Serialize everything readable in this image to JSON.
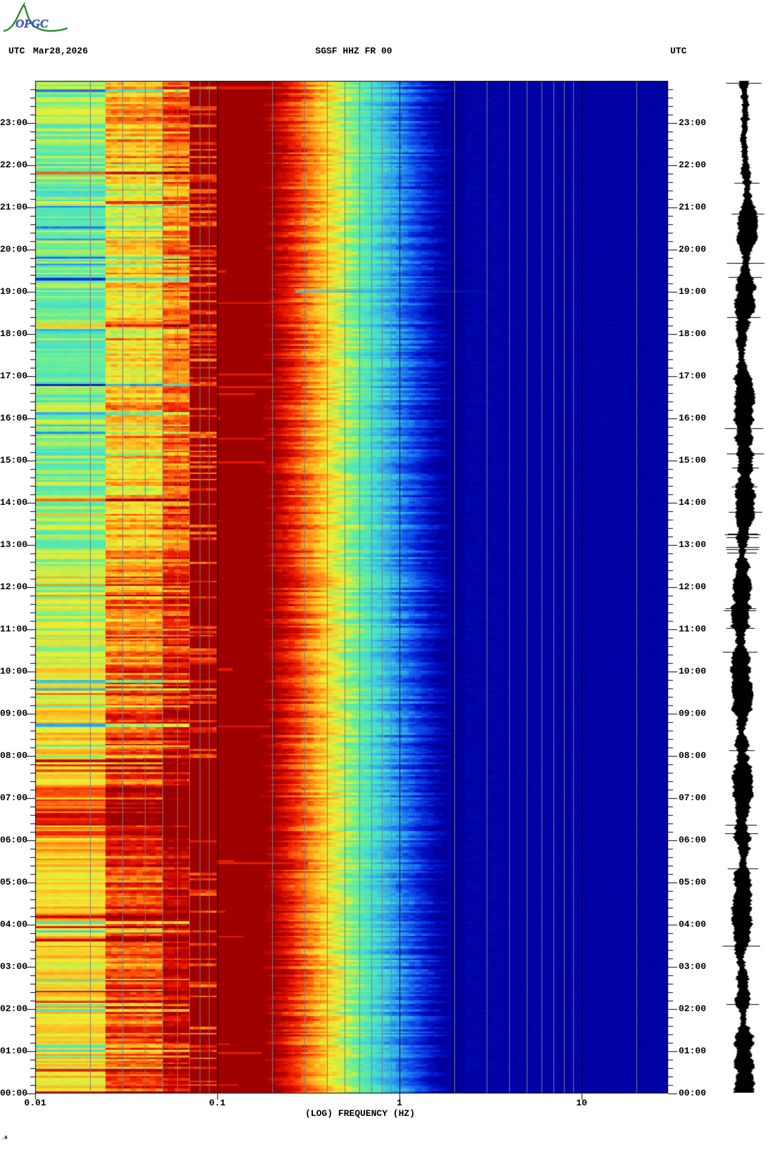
{
  "header": {
    "utc_left": "UTC",
    "date": "Mar28,2026",
    "station": "SGSF HHZ FR 00",
    "utc_right": "UTC"
  },
  "logo": {
    "text": "OPGC"
  },
  "corner_mark": ".H",
  "colors": {
    "background": "#ffffff",
    "grid": "#7d7d7d",
    "decade_line": "#000000",
    "maroon": "#880000",
    "navy": "#0000a0",
    "trace": "#000000",
    "text": "#000000",
    "logo_green": "#2e8b2e",
    "logo_blue": "#3a5fc8"
  },
  "chart_data": {
    "type": "heatmap",
    "subtype": "seismic-spectrogram-with-time-axis-vertical",
    "title": "SGSF HHZ FR 00",
    "date": "Mar28,2026",
    "xlabel": "(LOG) FREQUENCY (HZ)",
    "x_scale": "log",
    "x_range_hz": [
      0.01,
      29.5
    ],
    "x_tick_labels": [
      "0.01",
      "0.1",
      "1",
      "10"
    ],
    "x_tick_values": [
      0.01,
      0.1,
      1,
      10
    ],
    "gridlines_hz": [
      0.02,
      0.03,
      0.04,
      0.05,
      0.06,
      0.07,
      0.08,
      0.09,
      0.2,
      0.3,
      0.4,
      0.5,
      0.6,
      0.7,
      0.8,
      0.9,
      2,
      3,
      4,
      5,
      6,
      7,
      8,
      9,
      20
    ],
    "decade_lines_hz": [
      0.1,
      1,
      10
    ],
    "y_axis": {
      "kind": "time-utc",
      "top": "24:00",
      "bottom": "00:00",
      "hours_span": 24,
      "minor_ticks_per_hour": 5,
      "hour_labels": [
        "23:00",
        "22:00",
        "21:00",
        "20:00",
        "19:00",
        "18:00",
        "17:00",
        "16:00",
        "15:00",
        "14:00",
        "13:00",
        "12:00",
        "11:00",
        "10:00",
        "09:00",
        "08:00",
        "07:00",
        "06:00",
        "05:00",
        "04:00",
        "03:00",
        "02:00",
        "01:00",
        "00:00"
      ]
    },
    "legend": "none",
    "grid_on": true,
    "palette_stops": [
      [
        0.0,
        "#000088"
      ],
      [
        0.05,
        "#0000a0"
      ],
      [
        0.12,
        "#0011c8"
      ],
      [
        0.2,
        "#1155ee"
      ],
      [
        0.28,
        "#2fa8ee"
      ],
      [
        0.36,
        "#44dcd2"
      ],
      [
        0.44,
        "#66ee99"
      ],
      [
        0.5,
        "#b4ee55"
      ],
      [
        0.57,
        "#eeee33"
      ],
      [
        0.65,
        "#ffbb22"
      ],
      [
        0.73,
        "#ff7711"
      ],
      [
        0.81,
        "#ee2200"
      ],
      [
        0.9,
        "#c00000"
      ],
      [
        1.0,
        "#880000"
      ]
    ],
    "level_profile_hour_vs_level": [
      [
        0,
        0.6
      ],
      [
        1,
        0.58
      ],
      [
        2,
        0.62
      ],
      [
        3,
        0.6
      ],
      [
        4,
        0.63
      ],
      [
        5,
        0.6
      ],
      [
        5.8,
        0.66
      ],
      [
        6.3,
        0.78
      ],
      [
        7.0,
        0.74
      ],
      [
        7.6,
        0.6
      ],
      [
        8.5,
        0.62
      ],
      [
        9.5,
        0.59
      ],
      [
        10.2,
        0.55
      ],
      [
        11,
        0.52
      ],
      [
        12,
        0.51
      ],
      [
        13,
        0.48
      ],
      [
        14,
        0.47
      ],
      [
        15,
        0.45
      ],
      [
        16,
        0.46
      ],
      [
        17,
        0.44
      ],
      [
        18,
        0.45
      ],
      [
        19,
        0.44
      ],
      [
        20,
        0.46
      ],
      [
        21,
        0.44
      ],
      [
        21.8,
        0.47
      ],
      [
        22.5,
        0.44
      ],
      [
        23.2,
        0.48
      ],
      [
        24,
        0.5
      ]
    ],
    "bands": [
      {
        "hz": "0.01-0.038",
        "desc": "time-varying horizontal stripes cyan/green/yellow/orange; hotter (orange-red) before 10:00 UTC"
      },
      {
        "hz": "0.038-0.07",
        "desc": "hotter stripes yellow/orange/red, alternating dark red rows in early hours"
      },
      {
        "hz": "0.07-0.1",
        "desc": "dark red column with interleaved bright red stripes"
      },
      {
        "hz": "0.1-0.2",
        "desc": "saturated solid dark red (maroon) microseism band"
      },
      {
        "hz": "0.2-0.45",
        "desc": "jagged transition maroon-red-orange-yellow"
      },
      {
        "hz": "0.45-0.8",
        "desc": "cyan fading to light blue and blue"
      },
      {
        "hz": "0.8-29.5",
        "desc": "navy background, slightly darker 1-2 Hz, faint speckles near 9-20 Hz around 09:00-10:00"
      }
    ],
    "features": [
      {
        "time": "19:00",
        "desc": "thin light-blue/cyan horizontal streak extending 0.3-3 Hz"
      },
      {
        "time": "06:10-07:00",
        "desc": "dark red band across low frequencies"
      },
      {
        "time": "00:00-10:00",
        "desc": "overall hotter low-frequency levels with red streaks into 0.1-0.2 Hz band"
      }
    ],
    "waveform": {
      "position": "right-margin",
      "desc": "vertical filled black helicorder-style trace, 24 h, aligned with time axis",
      "color": "#000000"
    }
  }
}
